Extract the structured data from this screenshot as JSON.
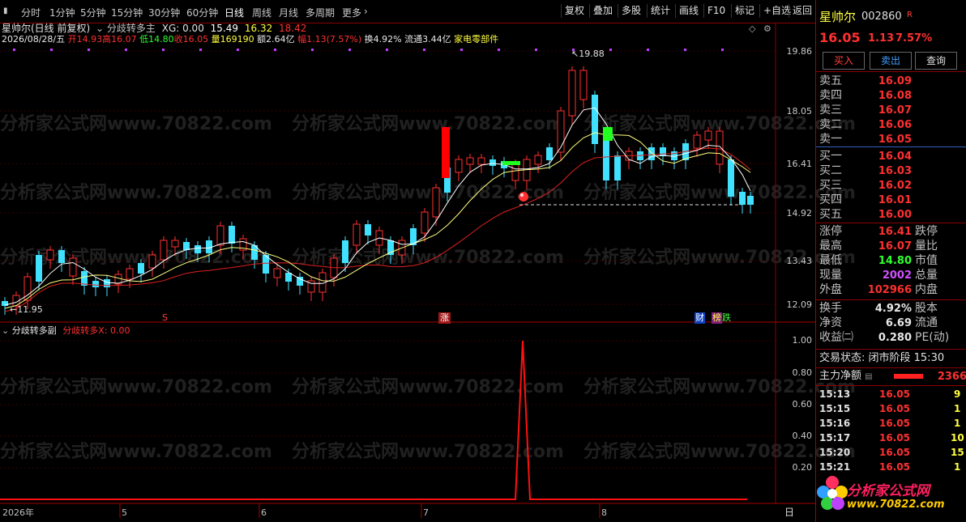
{
  "toolbar": {
    "periods": [
      "分时",
      "1分钟",
      "5分钟",
      "15分钟",
      "30分钟",
      "60分钟",
      "日线",
      "周线",
      "月线",
      "多周期",
      "更多"
    ],
    "active_period": "日线",
    "actions": [
      "复权",
      "叠加",
      "多股",
      "统计",
      "画线",
      "F10",
      "标记",
      "+自选",
      "返回"
    ]
  },
  "main": {
    "title": "星帅尔(日线 前复权)",
    "indicator_name": "分歧转多主",
    "xg_label": "XG: 0.00",
    "ma_values": [
      "15.49",
      "16.32",
      "18.42"
    ],
    "ma_colors": [
      "#ffffff",
      "#ffff40",
      "#ff3030"
    ],
    "info": {
      "date": "2026/08/28/五",
      "open": "开14.93",
      "high": "高16.07",
      "low": "低14.80",
      "close": "收16.05",
      "volume": "量169190",
      "amount": "额2.64亿",
      "change": "幅1.13(7.57%)",
      "turnover": "换4.92%",
      "float": "流通3.44亿",
      "sector": "家电零部件"
    },
    "high_label": "19.88",
    "low_label": "11.95",
    "price_axis": [
      "19.86",
      "18.05",
      "16.41",
      "14.92",
      "13.43",
      "12.09"
    ],
    "markers": {
      "s": "S",
      "zhang": "涨",
      "cai": "财",
      "bang": "榜",
      "die": "跌"
    }
  },
  "sub": {
    "title": "分歧转多副",
    "value_label": "分歧转多X: 0.00",
    "axis": [
      "1.00",
      "0.80",
      "0.60",
      "0.40",
      "0.20"
    ]
  },
  "time_axis": {
    "labels": [
      "2026年",
      "5",
      "6",
      "7",
      "8"
    ],
    "period": "日"
  },
  "quote": {
    "name": "星帅尔",
    "code": "002860",
    "flag": "R",
    "price": "16.05",
    "change": "1.13",
    "pct": "7.57%",
    "buttons": [
      "买入",
      "卖出",
      "查询"
    ],
    "asks": [
      {
        "label": "卖五",
        "price": "16.09"
      },
      {
        "label": "卖四",
        "price": "16.08"
      },
      {
        "label": "卖三",
        "price": "16.07"
      },
      {
        "label": "卖二",
        "price": "16.06"
      },
      {
        "label": "卖一",
        "price": "16.05"
      }
    ],
    "bids": [
      {
        "label": "买一",
        "price": "16.04"
      },
      {
        "label": "买二",
        "price": "16.03"
      },
      {
        "label": "买三",
        "price": "16.02"
      },
      {
        "label": "买四",
        "price": "16.01"
      },
      {
        "label": "买五",
        "price": "16.00"
      }
    ],
    "stats": [
      {
        "label": "涨停",
        "value": "16.41",
        "right": "跌停",
        "color": "#ff3030"
      },
      {
        "label": "最高",
        "value": "16.07",
        "right": "量比",
        "color": "#ff3030"
      },
      {
        "label": "最低",
        "value": "14.80",
        "right": "市值",
        "color": "#30ff30"
      },
      {
        "label": "现量",
        "value": "2002",
        "right": "总量",
        "color": "#d050ff"
      },
      {
        "label": "外盘",
        "value": "102966",
        "right": "内盘",
        "color": "#ff3030"
      }
    ],
    "stats2": [
      {
        "label": "换手",
        "value": "4.92%",
        "right": "股本"
      },
      {
        "label": "净资",
        "value": "6.69",
        "right": "流通"
      },
      {
        "label": "收益㈡",
        "value": "0.280",
        "right": "PE(动)"
      }
    ],
    "trade_status": "交易状态: 闭市阶段 15:30",
    "main_flow_label": "主力净额",
    "main_flow_value": "2366",
    "ticks": [
      {
        "time": "15:13",
        "price": "16.05",
        "vol": "9"
      },
      {
        "time": "15:15",
        "price": "16.05",
        "vol": "1"
      },
      {
        "time": "15:16",
        "price": "16.05",
        "vol": "1"
      },
      {
        "time": "15:17",
        "price": "16.05",
        "vol": "10"
      },
      {
        "time": "15:20",
        "price": "16.05",
        "vol": "15"
      },
      {
        "time": "15:21",
        "price": "16.05",
        "vol": "1"
      }
    ]
  },
  "logo": {
    "text": "分析家公式网",
    "url": "www.70822.com"
  },
  "watermark": "分析家公式网www.70822.com"
}
